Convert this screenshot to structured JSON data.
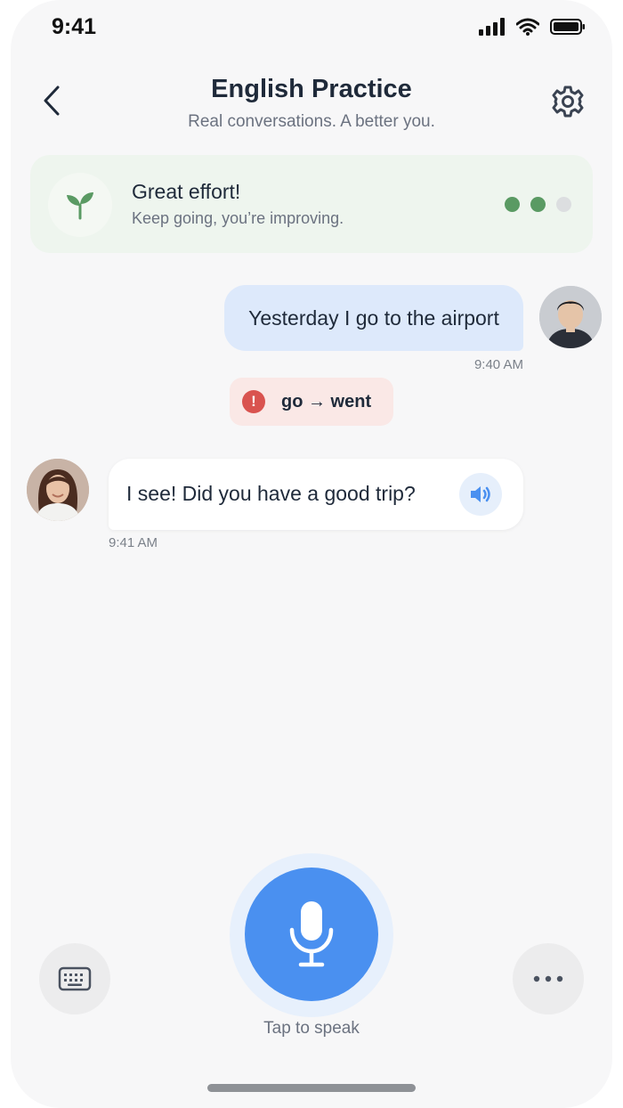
{
  "status_bar": {
    "time": "9:41"
  },
  "header": {
    "title": "English Practice",
    "subtitle": "Real conversations. A better you."
  },
  "feedback": {
    "title": "Great effort!",
    "subtitle": "Keep going, you’re improving.",
    "progress": {
      "completed": 2,
      "total": 3
    }
  },
  "messages": {
    "user": {
      "text": "Yesterday I go to the airport",
      "time": "9:40 AM"
    },
    "correction": {
      "text": "go → went",
      "icon": "!"
    },
    "tutor": {
      "text": "I see! Did you have a good trip?",
      "time": "9:41 AM"
    }
  },
  "controls": {
    "mic_label": "Tap to speak"
  },
  "colors": {
    "accent": "#4a90f0",
    "user_bubble": "#dde9fb",
    "feedback_bg": "#eef5ee",
    "progress_on": "#5a9a63",
    "error": "#d9534f"
  }
}
